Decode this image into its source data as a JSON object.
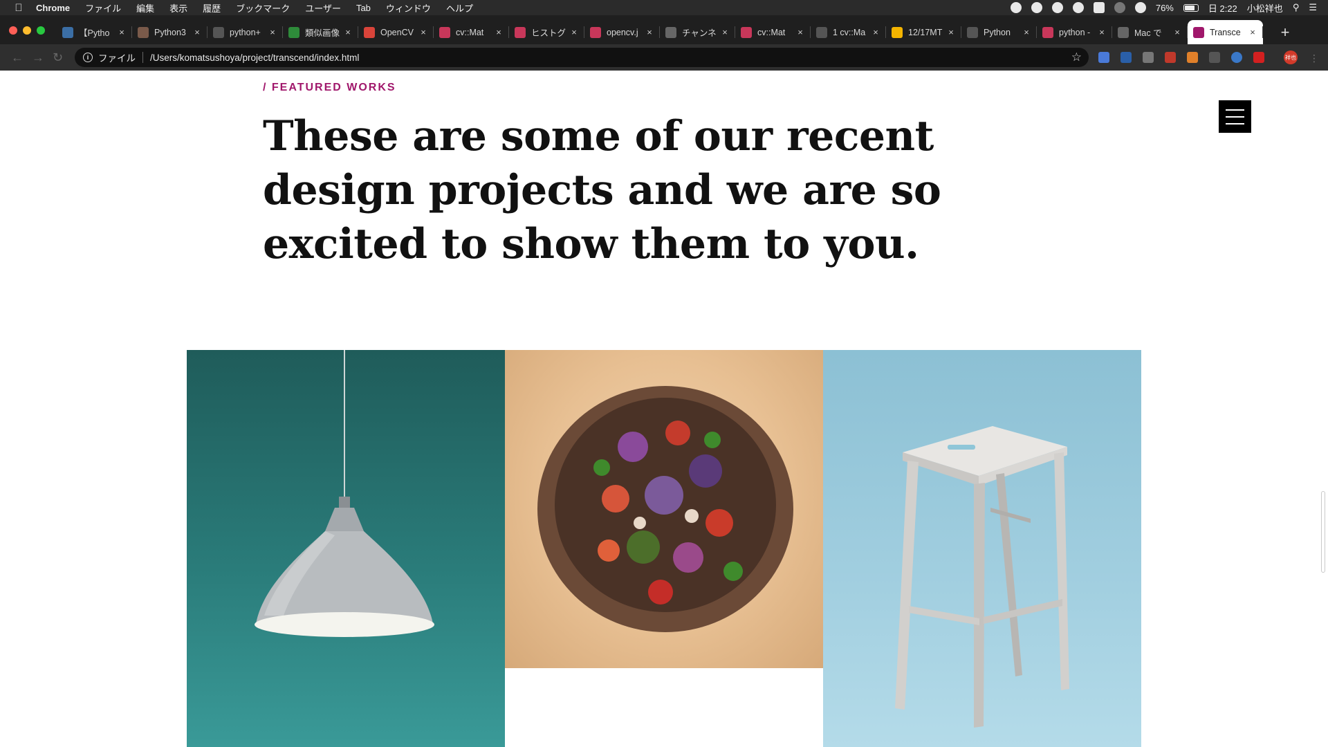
{
  "menubar": {
    "app_name": "Chrome",
    "items": [
      "ファイル",
      "編集",
      "表示",
      "履歴",
      "ブックマーク",
      "ユーザー",
      "Tab",
      "ウィンドウ",
      "ヘルプ"
    ],
    "battery": "76%",
    "clock": "日 2:22",
    "user": "小松祥也"
  },
  "tabs": [
    {
      "title": "【Pytho",
      "fav_color": "#3b6ea5"
    },
    {
      "title": "Python3",
      "fav_color": "#7a5a4a"
    },
    {
      "title": "python+",
      "fav_color": "#555555"
    },
    {
      "title": "類似画像",
      "fav_color": "#2e8b3a"
    },
    {
      "title": "OpenCV",
      "fav_color": "#d9443a"
    },
    {
      "title": "cv::Mat",
      "fav_color": "#c8375a"
    },
    {
      "title": "ヒストグ",
      "fav_color": "#c8375a"
    },
    {
      "title": "opencv.j",
      "fav_color": "#c8375a"
    },
    {
      "title": "チャンネ",
      "fav_color": "#666666"
    },
    {
      "title": "cv::Mat",
      "fav_color": "#c8375a"
    },
    {
      "title": "1 cv::Ma",
      "fav_color": "#555555"
    },
    {
      "title": "12/17MT",
      "fav_color": "#f4b400"
    },
    {
      "title": "Python",
      "fav_color": "#555555"
    },
    {
      "title": "python -",
      "fav_color": "#c8375a"
    },
    {
      "title": "Mac で",
      "fav_color": "#666666"
    },
    {
      "title": "Transce",
      "fav_color": "#a0176b"
    }
  ],
  "address_bar": {
    "scheme_label": "ファイル",
    "url": "/Users/komatsushoya/project/transcend/index.html"
  },
  "profile_label": "祥也",
  "page": {
    "eyebrow": "/ FEATURED WORKS",
    "headline": "These are some of our recent design projects and we are so excited to show them to you.",
    "accent_color": "#a0176b",
    "gallery": [
      {
        "subject": "pendant lamp",
        "bg": "#2a7c7a"
      },
      {
        "subject": "salad bowl",
        "bg": "#e7bf92"
      },
      {
        "subject": "wooden stool",
        "bg": "#a2cfe0"
      }
    ]
  }
}
